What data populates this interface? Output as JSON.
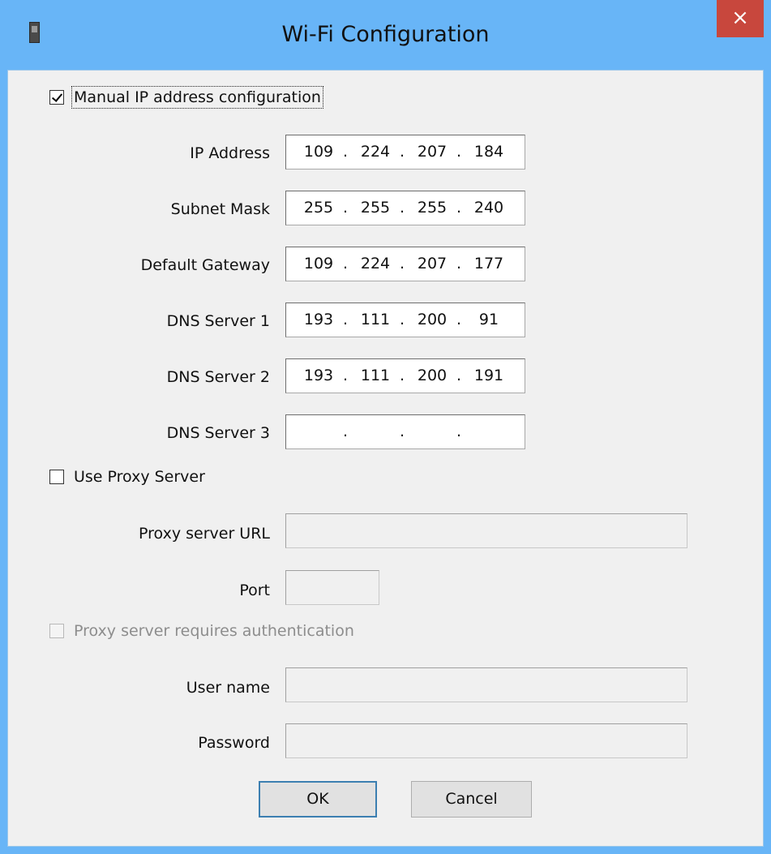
{
  "window": {
    "title": "Wi-Fi Configuration",
    "close_glyph": "×",
    "icon": "device-icon"
  },
  "manual_ip": {
    "label": "Manual IP address configuration",
    "checked": true
  },
  "ip_fields": [
    {
      "label": "IP Address",
      "octets": [
        "109",
        "224",
        "207",
        "184"
      ]
    },
    {
      "label": "Subnet Mask",
      "octets": [
        "255",
        "255",
        "255",
        "240"
      ]
    },
    {
      "label": "Default Gateway",
      "octets": [
        "109",
        "224",
        "207",
        "177"
      ]
    },
    {
      "label": "DNS Server 1",
      "octets": [
        "193",
        "111",
        "200",
        "91"
      ]
    },
    {
      "label": "DNS Server 2",
      "octets": [
        "193",
        "111",
        "200",
        "191"
      ]
    },
    {
      "label": "DNS Server 3",
      "octets": [
        "",
        "",
        "",
        ""
      ]
    }
  ],
  "ip_separator": ".",
  "proxy": {
    "use_label": "Use Proxy Server",
    "use_checked": false,
    "url_label": "Proxy server URL",
    "url_value": "",
    "port_label": "Port",
    "port_value": "",
    "auth_label": "Proxy server requires authentication",
    "auth_checked": false,
    "username_label": "User name",
    "username_value": "",
    "password_label": "Password",
    "password_value": ""
  },
  "buttons": {
    "ok": "OK",
    "cancel": "Cancel"
  },
  "colors": {
    "titlebar": "#68b5f7",
    "close": "#c8473d",
    "dialog_bg": "#f0f0f0"
  }
}
